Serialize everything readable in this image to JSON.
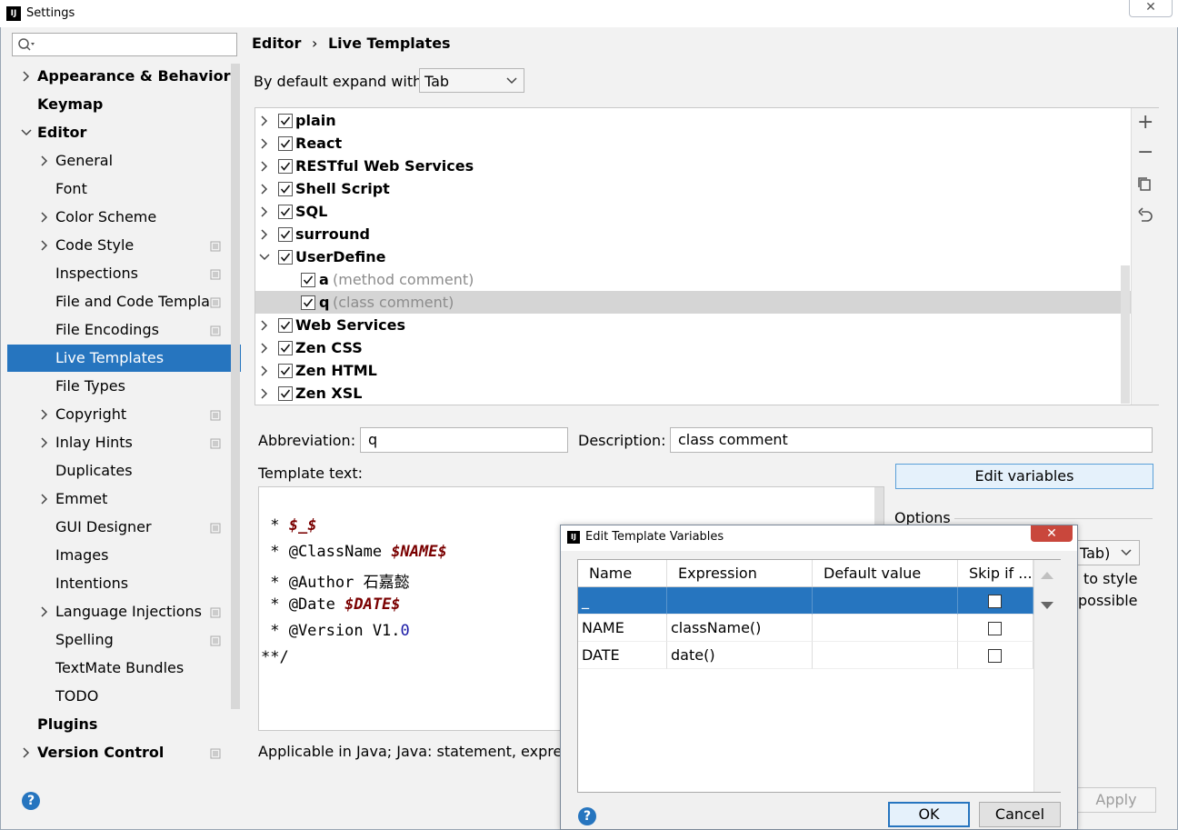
{
  "window": {
    "title": "Settings"
  },
  "sidebar": {
    "search_placeholder": "",
    "items": [
      {
        "label": "Appearance & Behavior",
        "level": 0,
        "bold": true,
        "chevron": "right"
      },
      {
        "label": "Keymap",
        "level": 0,
        "bold": true,
        "chevron": "none"
      },
      {
        "label": "Editor",
        "level": 0,
        "bold": true,
        "chevron": "down"
      },
      {
        "label": "General",
        "level": 1,
        "chevron": "right"
      },
      {
        "label": "Font",
        "level": 1,
        "chevron": "none"
      },
      {
        "label": "Color Scheme",
        "level": 1,
        "chevron": "right"
      },
      {
        "label": "Code Style",
        "level": 1,
        "chevron": "right",
        "project": true
      },
      {
        "label": "Inspections",
        "level": 1,
        "chevron": "none",
        "project": true
      },
      {
        "label": "File and Code Templa",
        "level": 1,
        "chevron": "none",
        "project": true
      },
      {
        "label": "File Encodings",
        "level": 1,
        "chevron": "none",
        "project": true
      },
      {
        "label": "Live Templates",
        "level": 1,
        "chevron": "none",
        "selected": true
      },
      {
        "label": "File Types",
        "level": 1,
        "chevron": "none"
      },
      {
        "label": "Copyright",
        "level": 1,
        "chevron": "right",
        "project": true
      },
      {
        "label": "Inlay Hints",
        "level": 1,
        "chevron": "right",
        "project": true
      },
      {
        "label": "Duplicates",
        "level": 1,
        "chevron": "none"
      },
      {
        "label": "Emmet",
        "level": 1,
        "chevron": "right"
      },
      {
        "label": "GUI Designer",
        "level": 1,
        "chevron": "none",
        "project": true
      },
      {
        "label": "Images",
        "level": 1,
        "chevron": "none"
      },
      {
        "label": "Intentions",
        "level": 1,
        "chevron": "none"
      },
      {
        "label": "Language Injections",
        "level": 1,
        "chevron": "right",
        "project": true
      },
      {
        "label": "Spelling",
        "level": 1,
        "chevron": "none",
        "project": true
      },
      {
        "label": "TextMate Bundles",
        "level": 1,
        "chevron": "none"
      },
      {
        "label": "TODO",
        "level": 1,
        "chevron": "none"
      },
      {
        "label": "Plugins",
        "level": 0,
        "bold": true,
        "chevron": "none"
      },
      {
        "label": "Version Control",
        "level": 0,
        "bold": true,
        "chevron": "right",
        "project": true
      }
    ]
  },
  "header": {
    "breadcrumb_parent": "Editor",
    "breadcrumb_sep": "›",
    "breadcrumb_current": "Live Templates"
  },
  "expand": {
    "label": "By default expand with",
    "value": "Tab"
  },
  "templates": [
    {
      "label": "plain",
      "group": true,
      "checked": true
    },
    {
      "label": "React",
      "group": true,
      "checked": true
    },
    {
      "label": "RESTful Web Services",
      "group": true,
      "checked": true
    },
    {
      "label": "Shell Script",
      "group": true,
      "checked": true
    },
    {
      "label": "SQL",
      "group": true,
      "checked": true
    },
    {
      "label": "surround",
      "group": true,
      "checked": true
    },
    {
      "label": "UserDefine",
      "group": true,
      "checked": true,
      "expanded": true
    },
    {
      "label": "a",
      "desc": "(method comment)",
      "group": false,
      "checked": true
    },
    {
      "label": "q",
      "desc": "(class comment)",
      "group": false,
      "checked": true,
      "selected": true
    },
    {
      "label": "Web Services",
      "group": true,
      "checked": true
    },
    {
      "label": "Zen CSS",
      "group": true,
      "checked": true
    },
    {
      "label": "Zen HTML",
      "group": true,
      "checked": true
    },
    {
      "label": "Zen XSL",
      "group": true,
      "checked": true
    }
  ],
  "tools": {
    "add": "+",
    "remove": "−",
    "copy": "copy-icon",
    "restore": "restore-icon"
  },
  "form": {
    "abbreviation_label": "Abbreviation:",
    "abbreviation_value": "q",
    "description_label": "Description:",
    "description_value": "class comment",
    "template_text_label": "Template text:",
    "edit_variables": "Edit variables",
    "options_label": "Options",
    "options_select_partial": "Tab)",
    "options_line1_partial": "to style",
    "options_line2_partial": "possible",
    "applicable": "Applicable in Java; Java: statement, expressi"
  },
  "code": {
    "l1_prefix": " * ",
    "l1_var": "$_$",
    "l2_prefix": " * @ClassName ",
    "l2_var": "$NAME$",
    "l3_text": " * @Author 石嘉懿",
    "l4_prefix": " * @Date ",
    "l4_var": "$DATE$",
    "l5_prefix": " * @Version V1.",
    "l5_num": "0",
    "l6_text": "**/"
  },
  "buttons": {
    "apply": "Apply",
    "help": "?"
  },
  "dialog": {
    "title": "Edit Template Variables",
    "close": "✕",
    "columns": [
      "Name",
      "Expression",
      "Default value",
      "Skip if ..."
    ],
    "rows": [
      {
        "name": "_",
        "expression": "",
        "default": "",
        "skip": false,
        "selected": true
      },
      {
        "name": "NAME",
        "expression": "className()",
        "default": "",
        "skip": false
      },
      {
        "name": "DATE",
        "expression": "date()",
        "default": "",
        "skip": false
      }
    ],
    "ok": "OK",
    "cancel": "Cancel"
  }
}
